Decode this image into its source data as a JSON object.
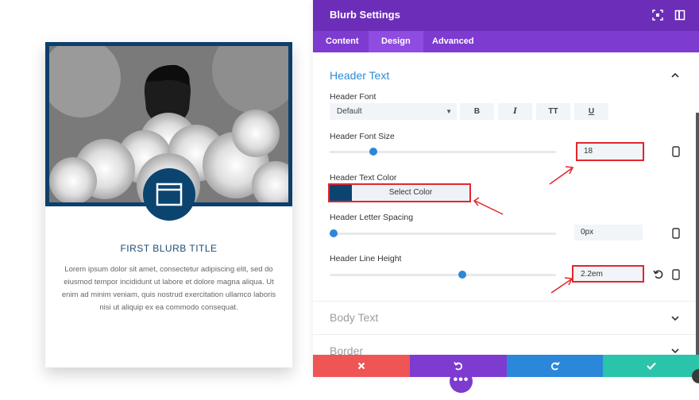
{
  "preview": {
    "title": "FIRST BLURB TITLE",
    "body": "Lorem ipsum dolor sit amet, consectetur adipiscing elit, sed do eiusmod tempor incididunt ut labore et dolore magna aliqua. Ut enim ad minim veniam, quis nostrud exercitation ullamco laboris nisi ut aliquip ex ea commodo consequat.",
    "badge_icon": "browser-window-icon",
    "accent_color": "#0c4470"
  },
  "panel": {
    "title": "Blurb Settings",
    "header_icons": [
      "expand-icon",
      "sidebar-toggle-icon"
    ],
    "tabs": [
      {
        "label": "Content",
        "active": false
      },
      {
        "label": "Design",
        "active": true
      },
      {
        "label": "Advanced",
        "active": false
      }
    ],
    "header_text": {
      "section_title": "Header Text",
      "font": {
        "label": "Header Font",
        "value": "Default",
        "styles": [
          "B",
          "I",
          "TT",
          "U"
        ]
      },
      "font_size": {
        "label": "Header Font Size",
        "value": "18",
        "slider_fraction": 0.18
      },
      "text_color": {
        "label": "Header Text Color",
        "button": "Select Color",
        "color": "#0c4470"
      },
      "letter_spacing": {
        "label": "Header Letter Spacing",
        "value": "0px",
        "slider_fraction": 0.0
      },
      "line_height": {
        "label": "Header Line Height",
        "value": "2.2em",
        "slider_fraction": 0.59
      }
    },
    "collapsed_sections": [
      "Body Text",
      "Border"
    ]
  },
  "footer": {
    "buttons": [
      {
        "name": "discard",
        "icon": "close-icon",
        "color": "#ef5555"
      },
      {
        "name": "undo",
        "icon": "undo-icon",
        "color": "#7e3bd0"
      },
      {
        "name": "redo",
        "icon": "redo-icon",
        "color": "#2b87da"
      },
      {
        "name": "save",
        "icon": "check-icon",
        "color": "#29c4a9"
      }
    ],
    "fab_label": "•••"
  },
  "colors": {
    "purple": "#6c2eb9",
    "tab_purple": "#7e3bd0",
    "blue": "#2d8bd4",
    "annotation_red": "#e3262c"
  }
}
